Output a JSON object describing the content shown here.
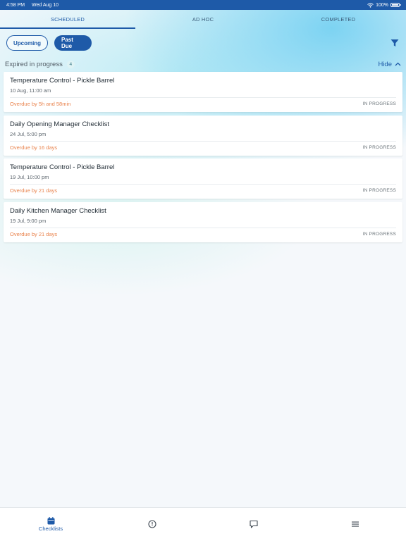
{
  "status_bar": {
    "time": "4:58 PM",
    "date": "Wed Aug 10",
    "battery": "100%"
  },
  "tabs": [
    {
      "label": "SCHEDULED",
      "active": true
    },
    {
      "label": "AD HOC",
      "active": false
    },
    {
      "label": "COMPLETED",
      "active": false
    }
  ],
  "filters": {
    "upcoming_label": "Upcoming",
    "past_due_label": "Past Due",
    "selected": "Past Due"
  },
  "section": {
    "title": "Expired in progress",
    "count": "4",
    "hide_label": "Hide"
  },
  "items": [
    {
      "title": "Temperature Control - Pickle Barrel",
      "date": "10 Aug, 11:00 am",
      "overdue": "Overdue by 5h and 58min",
      "status": "IN PROGRESS"
    },
    {
      "title": "Daily Opening Manager Checklist",
      "date": "24 Jul, 5:00 pm",
      "overdue": "Overdue by 16 days",
      "status": "IN PROGRESS"
    },
    {
      "title": "Temperature Control - Pickle Barrel",
      "date": "19 Jul, 10:00 pm",
      "overdue": "Overdue by 21 days",
      "status": "IN PROGRESS"
    },
    {
      "title": "Daily Kitchen Manager Checklist",
      "date": "19 Jul, 9:00 pm",
      "overdue": "Overdue by 21 days",
      "status": "IN PROGRESS"
    }
  ],
  "bottom_nav": [
    {
      "label": "Checklists",
      "icon": "calendar-icon",
      "active": true
    },
    {
      "label": "",
      "icon": "alert-circle-icon",
      "active": false
    },
    {
      "label": "",
      "icon": "chat-bubble-icon",
      "active": false
    },
    {
      "label": "",
      "icon": "menu-icon",
      "active": false
    }
  ],
  "colors": {
    "accent": "#1e5aa8",
    "overdue": "#e9834d",
    "background": "#f5f8fb"
  }
}
